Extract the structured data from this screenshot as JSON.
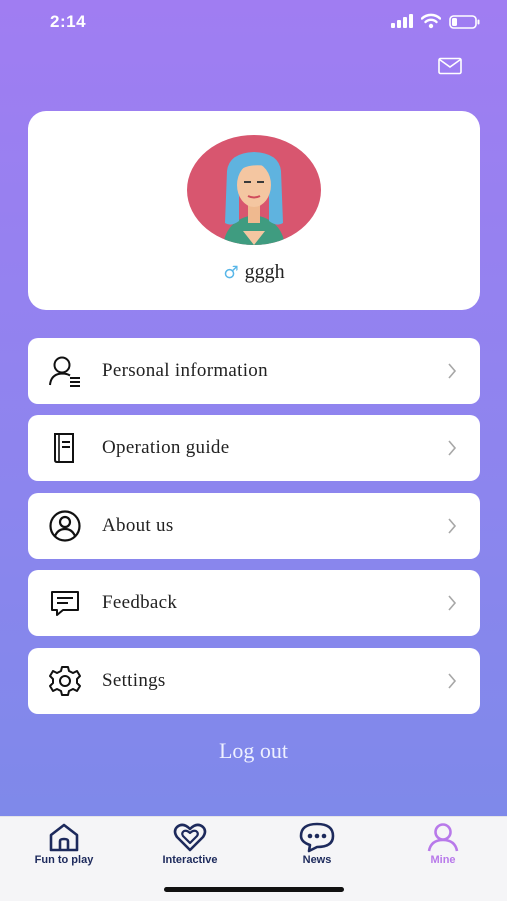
{
  "status_bar": {
    "time": "2:14"
  },
  "profile": {
    "gender_symbol": "♂",
    "username": "gggh"
  },
  "menu": [
    {
      "label": "Personal information",
      "icon": "user-list-icon"
    },
    {
      "label": "Operation guide",
      "icon": "book-icon"
    },
    {
      "label": "About us",
      "icon": "user-circle-icon"
    },
    {
      "label": "Feedback",
      "icon": "chat-icon"
    },
    {
      "label": "Settings",
      "icon": "gear-icon"
    }
  ],
  "logout_label": "Log out",
  "tabs": [
    {
      "label": "Fun to play",
      "icon": "home-icon"
    },
    {
      "label": "Interactive",
      "icon": "heart-icon"
    },
    {
      "label": "News",
      "icon": "chat-bubble-icon"
    },
    {
      "label": "Mine",
      "icon": "person-icon",
      "active": true
    }
  ],
  "colors": {
    "accent": "#b879ea",
    "tab_text": "#1d2a5c",
    "background_top": "#a07df2",
    "background_bottom": "#7b8ae9"
  }
}
